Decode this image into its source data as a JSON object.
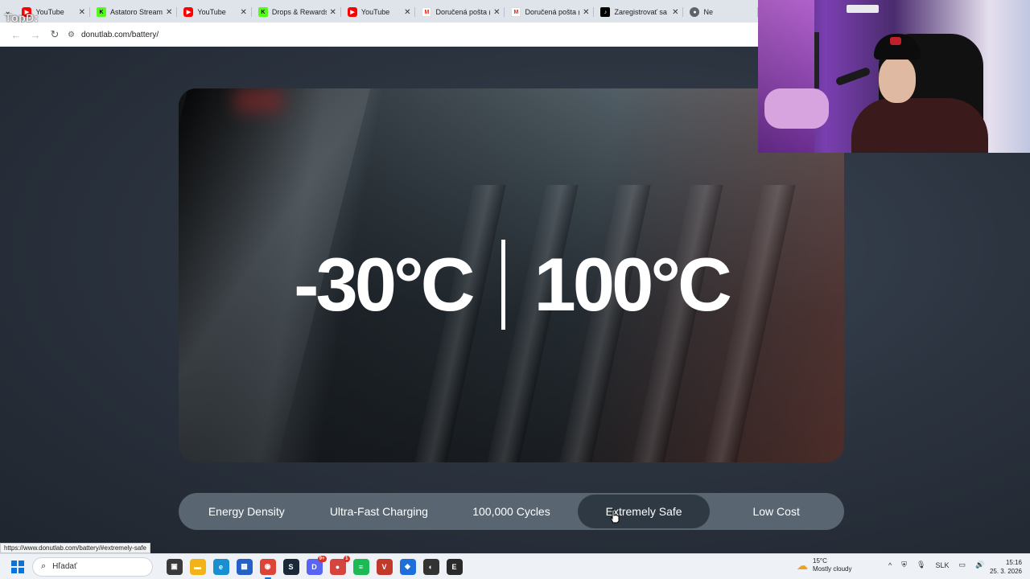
{
  "browser": {
    "watermark": "TopD:",
    "tabs": [
      {
        "title": "YouTube",
        "icon": "youtube-icon",
        "favicon": "yt",
        "glyph": "▶"
      },
      {
        "title": "Astatoro Stream",
        "icon": "kick-icon",
        "favicon": "kick",
        "glyph": "K"
      },
      {
        "title": "YouTube",
        "icon": "youtube-icon",
        "favicon": "yt",
        "glyph": "▶"
      },
      {
        "title": "Drops & Rewards",
        "icon": "kick-icon",
        "favicon": "kick",
        "glyph": "K"
      },
      {
        "title": "YouTube",
        "icon": "youtube-icon",
        "favicon": "yt",
        "glyph": "▶"
      },
      {
        "title": "Doručená pošta (",
        "icon": "gmail-icon",
        "favicon": "gmail",
        "glyph": "M"
      },
      {
        "title": "Doručená pošta (",
        "icon": "gmail-icon",
        "favicon": "gmail",
        "glyph": "M"
      },
      {
        "title": "Zaregistrovať sa |",
        "icon": "tiktok-icon",
        "favicon": "tiktok",
        "glyph": "♪"
      },
      {
        "title": "Ne",
        "icon": "globe-icon",
        "favicon": "globe",
        "glyph": "●"
      }
    ],
    "close_glyph": "✕",
    "url": "donutlab.com/battery/",
    "status_url": "https://www.donutlab.com/battery/#extremely-safe"
  },
  "hero": {
    "temp_low": "-30°C",
    "temp_high": "100°C"
  },
  "feature_tabs": [
    {
      "label": "Energy Density",
      "active": false
    },
    {
      "label": "Ultra-Fast Charging",
      "active": false
    },
    {
      "label": "100,000 Cycles",
      "active": false
    },
    {
      "label": "Extremely Safe",
      "active": true
    },
    {
      "label": "Low Cost",
      "active": false
    }
  ],
  "taskbar": {
    "search_placeholder": "Hľadať",
    "apps": [
      {
        "name": "task-view-icon",
        "color": "#3a3a3a",
        "glyph": "▣"
      },
      {
        "name": "file-explorer-icon",
        "color": "#f2b31a",
        "glyph": "▬"
      },
      {
        "name": "edge-icon",
        "color": "#1a8fd0",
        "glyph": "e"
      },
      {
        "name": "store-icon",
        "color": "#2560c7",
        "glyph": "▦"
      },
      {
        "name": "chrome-icon",
        "color": "#db4437",
        "glyph": "◉",
        "active": true
      },
      {
        "name": "steam-icon",
        "color": "#1b2838",
        "glyph": "S"
      },
      {
        "name": "discord-icon",
        "color": "#5865f2",
        "glyph": "D",
        "badge": "9+"
      },
      {
        "name": "app-red-icon",
        "color": "#d6453d",
        "glyph": "●",
        "badge": "1"
      },
      {
        "name": "spotify-icon",
        "color": "#1db954",
        "glyph": "≡"
      },
      {
        "name": "voicemeeter-icon",
        "color": "#c0392b",
        "glyph": "V"
      },
      {
        "name": "app-blue-icon",
        "color": "#1e6fd9",
        "glyph": "◆"
      },
      {
        "name": "app-dark-icon",
        "color": "#333333",
        "glyph": "◐"
      },
      {
        "name": "epic-games-icon",
        "color": "#2a2a2a",
        "glyph": "E"
      }
    ],
    "weather": {
      "temp": "15°C",
      "desc": "Mostly cloudy"
    },
    "language": "SLK",
    "time": "15:16",
    "date": "25. 3. 2026"
  }
}
